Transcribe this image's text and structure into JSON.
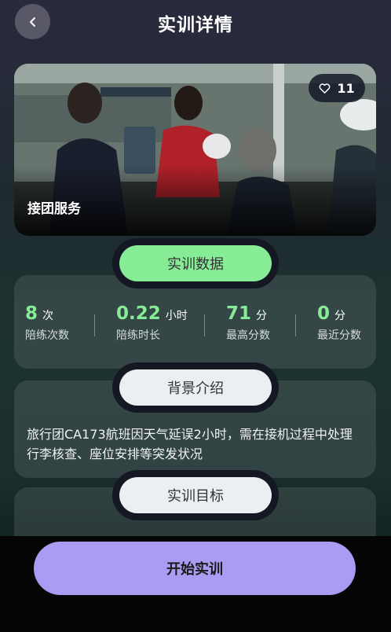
{
  "header": {
    "title": "实训详情",
    "back_icon": "chevron-left-icon"
  },
  "hero": {
    "caption": "接团服务",
    "like_count": "11",
    "like_icon": "heart-outline-icon"
  },
  "stats_section": {
    "title": "实训数据",
    "items": [
      {
        "value": "8",
        "unit": "次",
        "label": "陪练次数"
      },
      {
        "value": "0.22",
        "unit": "小时",
        "label": "陪练时长"
      },
      {
        "value": "71",
        "unit": "分",
        "label": "最高分数"
      },
      {
        "value": "0",
        "unit": "分",
        "label": "最近分数"
      }
    ]
  },
  "background_section": {
    "title": "背景介绍",
    "text": "旅行团CA173航班因天气延误2小时，需在接机过程中处理行李核查、座位安排等突发状况"
  },
  "goal_section": {
    "title": "实训目标"
  },
  "actions": {
    "start_label": "开始实训"
  },
  "colors": {
    "accent_green": "#86ec96",
    "button_purple": "#aa9cf2"
  }
}
